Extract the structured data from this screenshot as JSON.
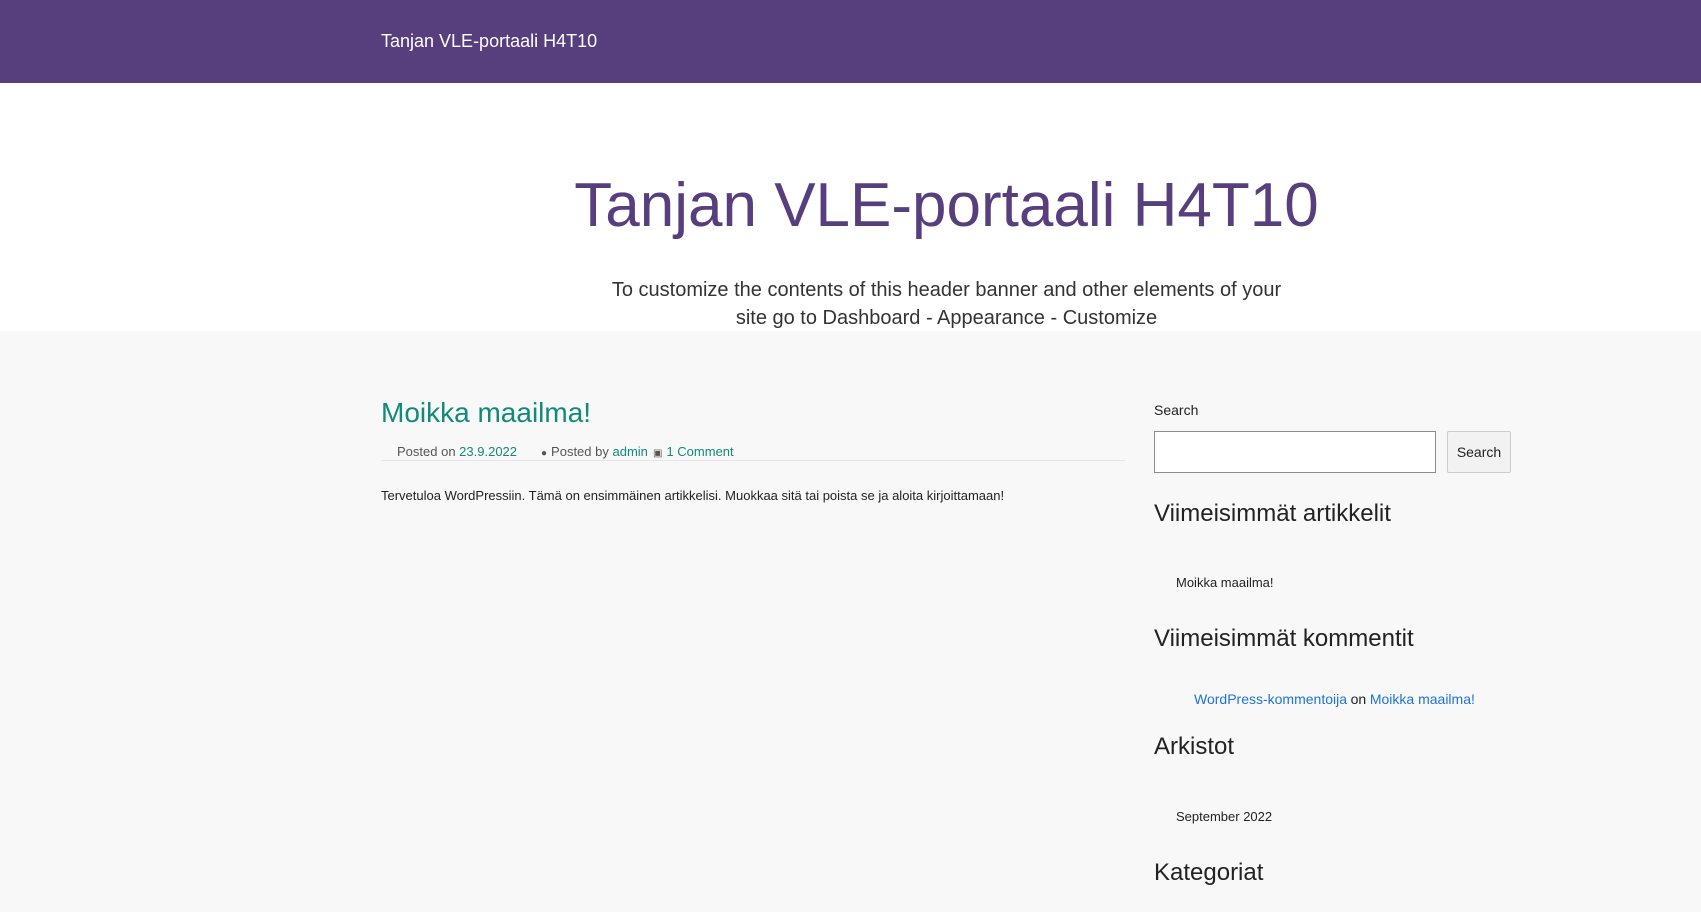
{
  "top_bar": {
    "site_name": "Tanjan VLE-portaali H4T10",
    "background_color": "#573e7d"
  },
  "header": {
    "title": "Tanjan VLE-portaali H4T10",
    "description": "To customize the contents of this header banner and other elements of your site go to Dashboard - Appearance - Customize"
  },
  "post": {
    "title": "Moikka maailma!",
    "posted_on_label": "Posted on",
    "date": "23.9.2022",
    "posted_by_label": "Posted by",
    "author": "admin",
    "comments": "1 Comment",
    "body": "Tervetuloa WordPressiin. Tämä on ensimmäinen artikkelisi. Muokkaa sitä tai poista se ja aloita kirjoittamaan!",
    "accent_color": "#118a7a"
  },
  "sidebar": {
    "search": {
      "label": "Search",
      "value": "",
      "button_label": "Search"
    },
    "recent_posts": {
      "title": "Viimeisimmät artikkelit",
      "items": [
        "Moikka maailma!"
      ]
    },
    "recent_comments": {
      "title": "Viimeisimmät kommentit",
      "items": [
        {
          "author": "WordPress-kommentoija",
          "on": "on",
          "post": "Moikka maailma!"
        }
      ]
    },
    "archives": {
      "title": "Arkistot",
      "items": [
        "September 2022"
      ]
    },
    "categories": {
      "title": "Kategoriat"
    }
  }
}
